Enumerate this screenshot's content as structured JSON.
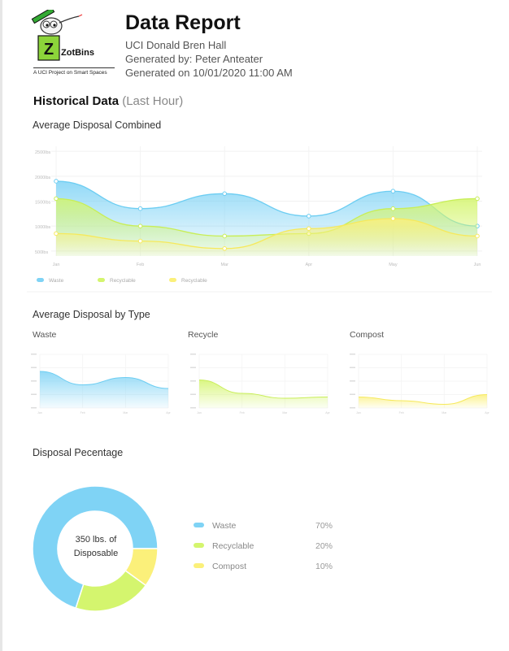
{
  "header": {
    "logo_text": "ZotBins",
    "logo_tagline": "A UCI Project on Smart Spaces",
    "title": "Data Report",
    "location": "UCI Donald Bren Hall",
    "generated_by": "Generated by: Peter Anteater",
    "generated_on": "Generated on 10/01/2020 11:00 AM"
  },
  "historical": {
    "title": "Historical Data",
    "title_suffix": "(Last Hour)"
  },
  "sections": {
    "combined": "Average Disposal Combined",
    "by_type": "Average Disposal by Type",
    "percentage": "Disposal Pecentage"
  },
  "colors": {
    "waste": "#7fd3f5",
    "recyclable": "#d4f56e",
    "compost": "#fbf07a"
  },
  "chart_data": [
    {
      "type": "area",
      "title": "Average Disposal Combined",
      "categories": [
        "Jan",
        "Feb",
        "Mar",
        "Apr",
        "May",
        "Jun"
      ],
      "yticks": [
        "2500lbs",
        "2000lbs",
        "1500lbs",
        "1000lbs",
        "500lbs"
      ],
      "ylim": [
        400,
        2600
      ],
      "grid": true,
      "legend_position": "bottom-left",
      "series": [
        {
          "name": "Waste",
          "values": [
            1900,
            1350,
            1650,
            1200,
            1700,
            1000
          ]
        },
        {
          "name": "Recyclable",
          "values": [
            1550,
            1000,
            800,
            850,
            1350,
            1550
          ]
        },
        {
          "name": "Recyclable",
          "values": [
            850,
            700,
            550,
            950,
            1150,
            800
          ]
        }
      ]
    },
    {
      "type": "area",
      "title": "Waste",
      "categories": [
        "Jan",
        "Feb",
        "Mar",
        "Apr"
      ],
      "ylim": [
        400,
        2600
      ],
      "series": [
        {
          "name": "",
          "values": [
            1900,
            1350,
            1650,
            1200
          ]
        }
      ]
    },
    {
      "type": "area",
      "title": "Recycle",
      "categories": [
        "Jan",
        "Feb",
        "Mar",
        "Apr"
      ],
      "ylim": [
        400,
        2600
      ],
      "series": [
        {
          "name": "",
          "values": [
            1550,
            1000,
            800,
            850
          ]
        }
      ]
    },
    {
      "type": "area",
      "title": "Compost",
      "categories": [
        "Jan",
        "Feb",
        "Mar",
        "Apr"
      ],
      "ylim": [
        400,
        2600
      ],
      "series": [
        {
          "name": "",
          "values": [
            850,
            700,
            550,
            950
          ]
        }
      ]
    },
    {
      "type": "pie",
      "title": "Disposal Pecentage",
      "center_line1": "350 lbs. of",
      "center_line2": "Disposable",
      "categories": [
        "Waste",
        "Recyclable",
        "Compost"
      ],
      "values": [
        70,
        20,
        10
      ],
      "labels": [
        "70%",
        "20%",
        "10%"
      ]
    }
  ]
}
